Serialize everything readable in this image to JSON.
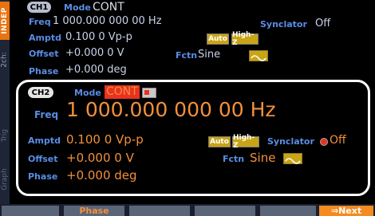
{
  "left_strip": {
    "indep": "INDEP",
    "tab_2ch": "2ch:",
    "tab_unused_1": "Trig",
    "tab_unused_2": "Graph"
  },
  "ch1": {
    "badge": "CH1",
    "mode_label": "Mode",
    "mode_value": "CONT",
    "freq_label": "Freq",
    "freq_value": "1 000.000 000 00 Hz",
    "synclator_label": "Synclator",
    "synclator_value": "Off",
    "amptd_label": "Amptd",
    "amptd_value": "0.100 0 Vp-p",
    "auto_btn": "Auto",
    "highz_btn": "High-Z",
    "offset_label": "Offset",
    "offset_value": "+0.000 0 V",
    "fctn_label": "Fctn",
    "fctn_value": "Sine",
    "phase_label": "Phase",
    "phase_value": "+0.000 deg"
  },
  "ch2": {
    "badge": "CH2",
    "mode_label": "Mode",
    "mode_value": "CONT",
    "freq_label": "Freq",
    "freq_value": "1 000.000 000 00 Hz",
    "amptd_label": "Amptd",
    "amptd_value": "0.100 0 Vp-p",
    "auto_btn": "Auto",
    "highz_btn": "High-Z",
    "synclator_label": "Synclator",
    "synclator_value": "Off",
    "offset_label": "Offset",
    "offset_value": "+0.000 0 V",
    "fctn_label": "Fctn",
    "fctn_value": "Sine",
    "phase_label": "Phase",
    "phase_value": "+0.000 deg"
  },
  "softkeys": [
    "",
    "Phase",
    "",
    "",
    "",
    "⇒Next"
  ],
  "colors": {
    "accent_orange": "#f2903b",
    "label_blue": "#5a8de6",
    "active_yellow": "#c9a415",
    "mode_red": "#e8321f"
  }
}
